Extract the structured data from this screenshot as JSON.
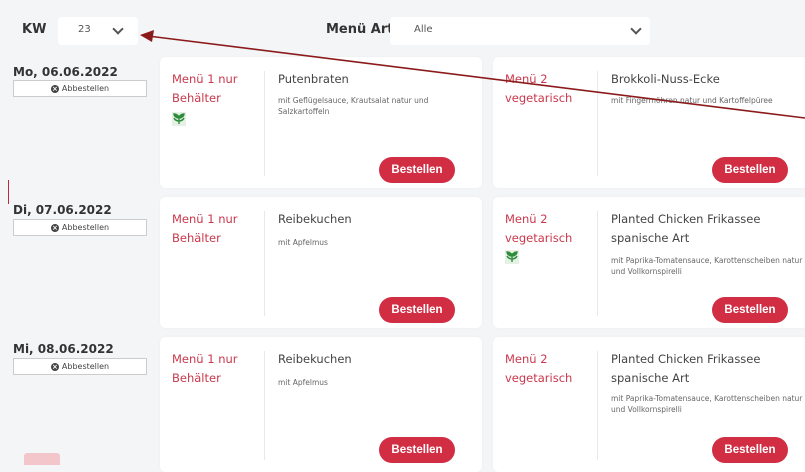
{
  "filters": {
    "kw_label": "KW",
    "kw_value": "23",
    "menu_art_label": "Menü Art",
    "menu_art_value": "Alle"
  },
  "cancel_label": "Abbestellen",
  "order_label": "Bestellen",
  "days": [
    {
      "date": "Mo, 06.06.2022",
      "menus": [
        {
          "name": "Menü 1 nur Behälter",
          "title": "Putenbraten",
          "description": "mit Geflügelsauce, Krautsalat natur und Salzkartoffeln",
          "veg_icon": true
        },
        {
          "name": "Menü 2 vegetarisch",
          "title": "Brokkoli-Nuss-Ecke",
          "description": "mit Fingermöhren natur und Kartoffelpüree",
          "veg_icon": false
        }
      ]
    },
    {
      "date": "Di, 07.06.2022",
      "menus": [
        {
          "name": "Menü 1 nur Behälter",
          "title": "Reibekuchen",
          "description": "mit Apfelmus",
          "veg_icon": false
        },
        {
          "name": "Menü 2 vegetarisch",
          "title": "Planted Chicken Frikassee spanische Art",
          "description": "mit Paprika-Tomatensauce, Karottenscheiben natur und Vollkornspirelli",
          "veg_icon": true
        }
      ]
    },
    {
      "date": "Mi, 08.06.2022",
      "menus": [
        {
          "name": "Menü 1 nur Behälter",
          "title": "Reibekuchen",
          "description": "mit Apfelmus",
          "veg_icon": false
        },
        {
          "name": "Menü 2 vegetarisch",
          "title": "Planted Chicken Frikassee spanische Art",
          "description": "mit Paprika-Tomatensauce, Karottenscheiben natur und Vollkornspirelli",
          "veg_icon": false
        }
      ]
    }
  ],
  "colors": {
    "accent": "#d12d43",
    "menu_text": "#c9384c",
    "background": "#f4f5f7",
    "veg_icon": "#2e8b3a"
  },
  "icons": {
    "cancel": "x-circle-icon",
    "dropdown": "chevron-down-icon",
    "vegetarian": "vegetarian-leaf-icon"
  }
}
